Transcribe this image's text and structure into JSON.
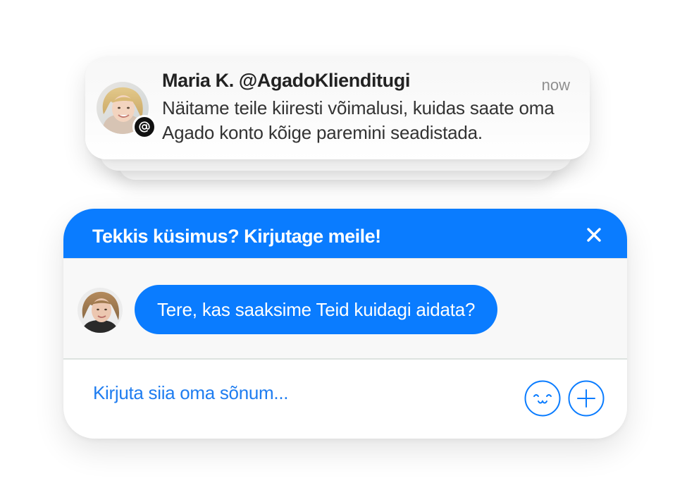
{
  "notification": {
    "sender_name": "Maria K.",
    "sender_handle": "@AgadoKlienditugi",
    "header_line": "Maria K. @AgadoKlienditugi",
    "time": "now",
    "message": "Näitame teile kiiresti võimalusi, kuidas saate oma Agado konto kõige paremini seadistada.",
    "avatar_icon": "person-photo",
    "badge_icon": "at-sign-icon"
  },
  "chat": {
    "header_title": "Tekkis küsimus? Kirjutage meile!",
    "close_icon": "close-icon",
    "agent_message": "Tere, kas saaksime Teid kuidagi aidata?",
    "input_placeholder": "Kirjuta siia oma sõnum...",
    "emoji_icon": "emoji-icon",
    "attach_icon": "plus-icon"
  },
  "colors": {
    "accent_blue": "#0a7cff",
    "placeholder_blue": "#1f7df0",
    "badge_black": "#111111",
    "text_dark": "#222222",
    "time_grey": "#8f8f8f"
  }
}
